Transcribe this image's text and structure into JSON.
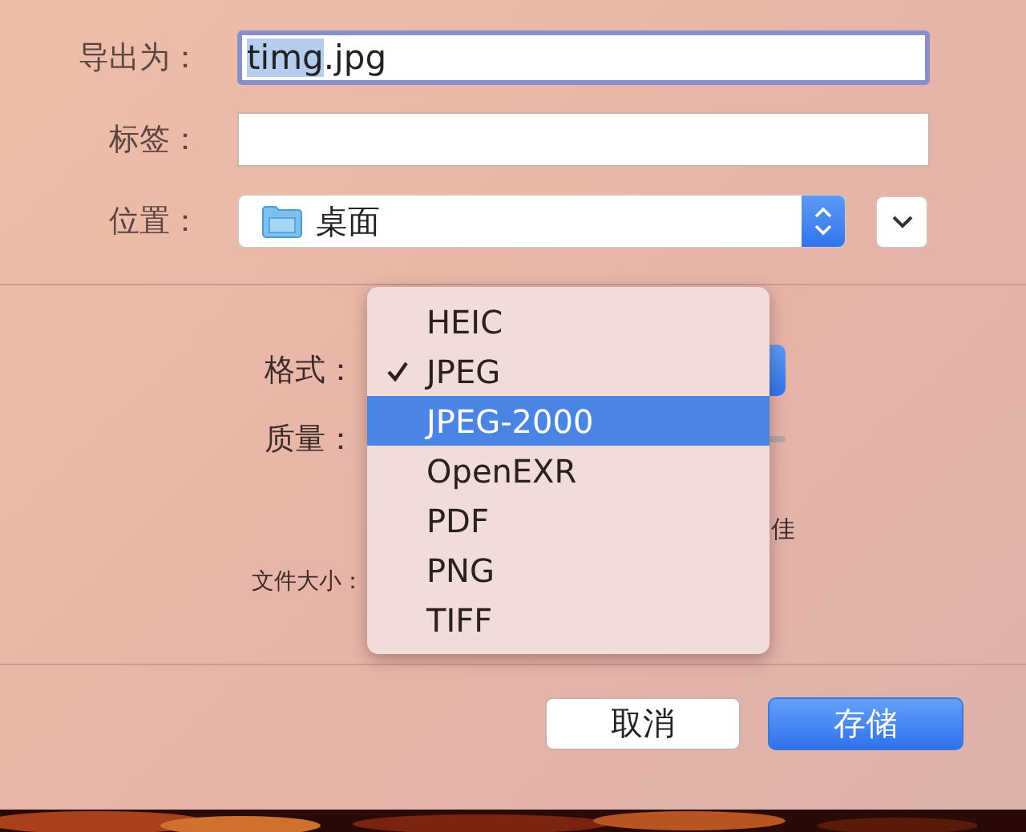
{
  "export_as": {
    "label": "导出为：",
    "value_selected": "timg",
    "value_rest": ".jpg",
    "focused": true
  },
  "tags": {
    "label": "标签："
  },
  "location": {
    "label": "位置：",
    "value": "桌面"
  },
  "format": {
    "label": "格式："
  },
  "quality": {
    "label": "质量：",
    "caption": "佳"
  },
  "file_size": {
    "label": "文件大小："
  },
  "format_menu": [
    {
      "label": "HEIC",
      "checked": false,
      "selected": false
    },
    {
      "label": "JPEG",
      "checked": true,
      "selected": false
    },
    {
      "label": "JPEG-2000",
      "checked": false,
      "selected": true
    },
    {
      "label": "OpenEXR",
      "checked": false,
      "selected": false
    },
    {
      "label": "PDF",
      "checked": false,
      "selected": false
    },
    {
      "label": "PNG",
      "checked": false,
      "selected": false
    },
    {
      "label": "TIFF",
      "checked": false,
      "selected": false
    }
  ],
  "buttons": [
    {
      "label": "取消",
      "kind": "default"
    },
    {
      "label": "存储",
      "kind": "primary"
    }
  ]
}
